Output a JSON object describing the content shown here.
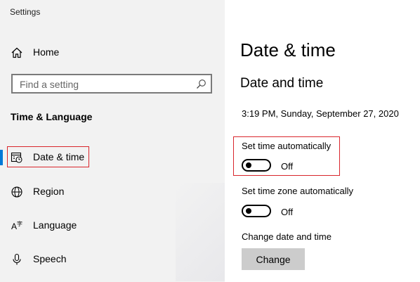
{
  "window": {
    "title": "Settings"
  },
  "sidebar": {
    "home_label": "Home",
    "search_placeholder": "Find a setting",
    "section_title": "Time & Language",
    "items": [
      {
        "label": "Date & time",
        "icon": "calendar-clock-icon",
        "active": true
      },
      {
        "label": "Region",
        "icon": "globe-icon",
        "active": false
      },
      {
        "label": "Language",
        "icon": "language-icon",
        "active": false
      },
      {
        "label": "Speech",
        "icon": "microphone-icon",
        "active": false
      }
    ]
  },
  "main": {
    "page_title": "Date & time",
    "subheading": "Date and time",
    "current_datetime": "3:19 PM, Sunday, September 27, 2020",
    "set_time_auto": {
      "label": "Set time automatically",
      "state": "Off"
    },
    "set_timezone_auto": {
      "label": "Set time zone automatically",
      "state": "Off"
    },
    "change_section": {
      "label": "Change date and time",
      "button": "Change"
    }
  },
  "colors": {
    "accent": "#0078d7",
    "highlight": "#d9262c",
    "sidebar_bg": "#f2f2f2",
    "button_bg": "#cccccc"
  }
}
